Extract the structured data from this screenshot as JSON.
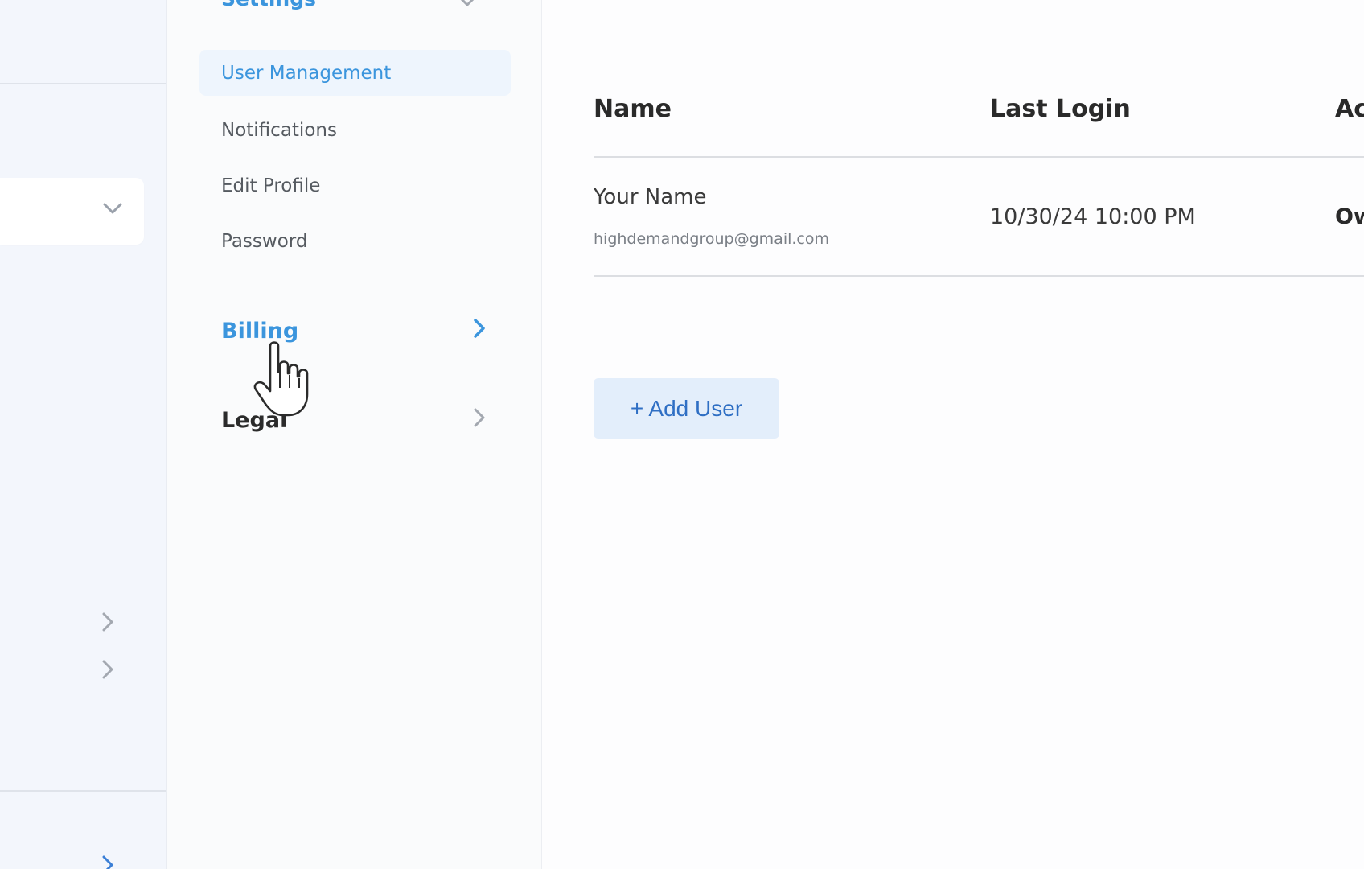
{
  "settings_nav": {
    "header": "Settings",
    "items": [
      {
        "label": "User Management",
        "active": true
      },
      {
        "label": "Notifications",
        "active": false
      },
      {
        "label": "Edit Profile",
        "active": false
      },
      {
        "label": "Password",
        "active": false
      }
    ],
    "sections": [
      {
        "label": "Billing",
        "state": "hovered"
      },
      {
        "label": "Legal",
        "state": "default"
      }
    ]
  },
  "users_table": {
    "columns": [
      "Name",
      "Last Login",
      "Ac"
    ],
    "rows": [
      {
        "name": "Your Name",
        "email": "highdemandgroup@gmail.com",
        "last_login": "10/30/24 10:00 PM",
        "access": "Ow"
      }
    ]
  },
  "actions": {
    "add_user_label": "+ Add User"
  },
  "colors": {
    "accent": "#3b95dd",
    "active_bg": "#eef5fd",
    "button_bg": "#e3eefb",
    "button_text": "#2f6fc4"
  },
  "icons": {
    "dropdown": "chevron-down-icon",
    "section_arrow": "chevron-right-icon",
    "cursor": "hand-pointer-cursor-icon"
  }
}
